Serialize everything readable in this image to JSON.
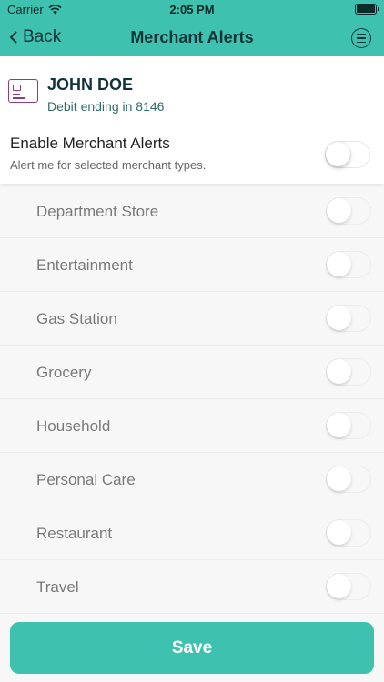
{
  "status_bar": {
    "carrier": "Carrier",
    "time": "2:05 PM"
  },
  "nav": {
    "back_label": "Back",
    "title": "Merchant Alerts"
  },
  "card": {
    "holder_name": "JOHN DOE",
    "description": "Debit ending in 8146"
  },
  "enable": {
    "title": "Enable Merchant Alerts",
    "subtitle": "Alert me for selected merchant types.",
    "enabled": false
  },
  "merchant_types": [
    {
      "label": "Department Store",
      "enabled": false
    },
    {
      "label": "Entertainment",
      "enabled": false
    },
    {
      "label": "Gas Station",
      "enabled": false
    },
    {
      "label": "Grocery",
      "enabled": false
    },
    {
      "label": "Household",
      "enabled": false
    },
    {
      "label": "Personal Care",
      "enabled": false
    },
    {
      "label": "Restaurant",
      "enabled": false
    },
    {
      "label": "Travel",
      "enabled": false
    }
  ],
  "footer": {
    "save_label": "Save"
  },
  "colors": {
    "accent": "#3ec1ae",
    "title_text": "#11343a",
    "card_icon": "#8e3b86"
  },
  "icons": {
    "back": "chevron-left-icon",
    "menu": "menu-icon",
    "card": "credit-card-icon",
    "wifi": "wifi-icon",
    "battery": "battery-icon"
  }
}
